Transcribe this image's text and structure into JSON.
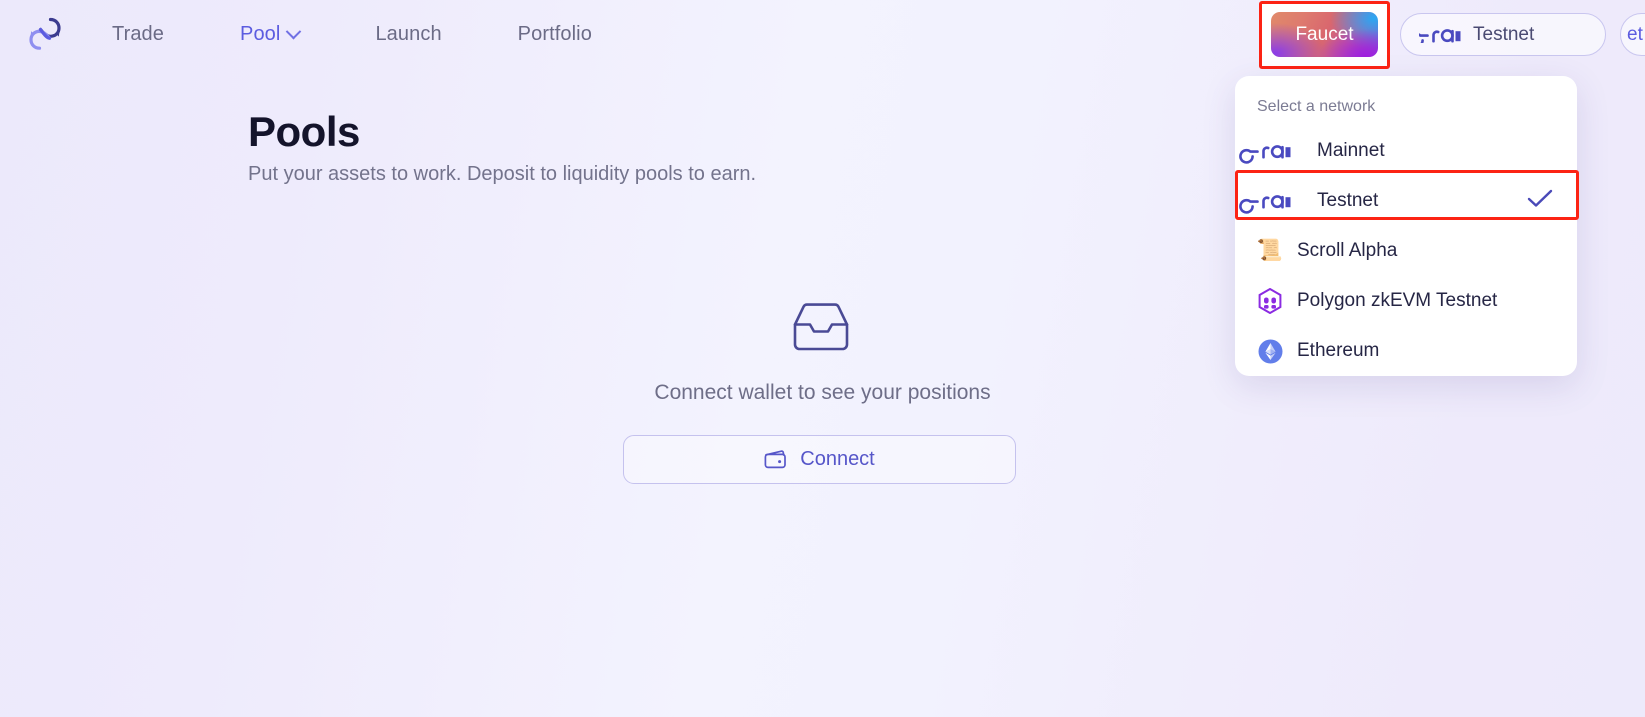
{
  "brand": {
    "logo_icon": "infinity-swap-logo",
    "accent_color": "#5c5ce0",
    "logo_dark": "#3b3b8f",
    "logo_light": "#8f8ff0"
  },
  "nav": {
    "items": [
      {
        "label": "Trade",
        "icon": "",
        "active": false
      },
      {
        "label": "Pool",
        "icon": "chevron-down-icon",
        "active": true
      },
      {
        "label": "Launch",
        "icon": "",
        "active": false
      },
      {
        "label": "Portfolio",
        "icon": "",
        "active": false
      }
    ]
  },
  "header_right": {
    "faucet_label": "Faucet",
    "faucet_gradient_from": "#e08a6a",
    "faucet_gradient_to": "#7c4ce0",
    "network_label": "Testnet",
    "network_logo": "era-logo",
    "edge_partial_label": "et"
  },
  "network_dropdown": {
    "title": "Select a network",
    "items": [
      {
        "label": "Mainnet",
        "icon": "era-logo",
        "selected": false
      },
      {
        "label": "Testnet",
        "icon": "era-logo",
        "selected": true
      },
      {
        "label": "Scroll Alpha",
        "icon": "scroll-icon",
        "glyph": "📜",
        "selected": false
      },
      {
        "label": "Polygon zkEVM Testnet",
        "icon": "polygon-icon",
        "selected": false
      },
      {
        "label": "Ethereum",
        "icon": "ethereum-icon",
        "selected": false
      }
    ],
    "check_icon": "check-icon",
    "check_color": "#4a4ab8"
  },
  "main": {
    "title": "Pools",
    "subtitle": "Put your assets to work. Deposit to liquidity pools to earn.",
    "empty_icon": "inbox-icon",
    "empty_message": "Connect wallet to see your positions",
    "connect_label": "Connect",
    "connect_icon": "wallet-icon"
  },
  "annotations": {
    "highlight_color": "#fc2314",
    "highlight_targets": [
      "faucet-button",
      "network-option-testnet"
    ]
  }
}
